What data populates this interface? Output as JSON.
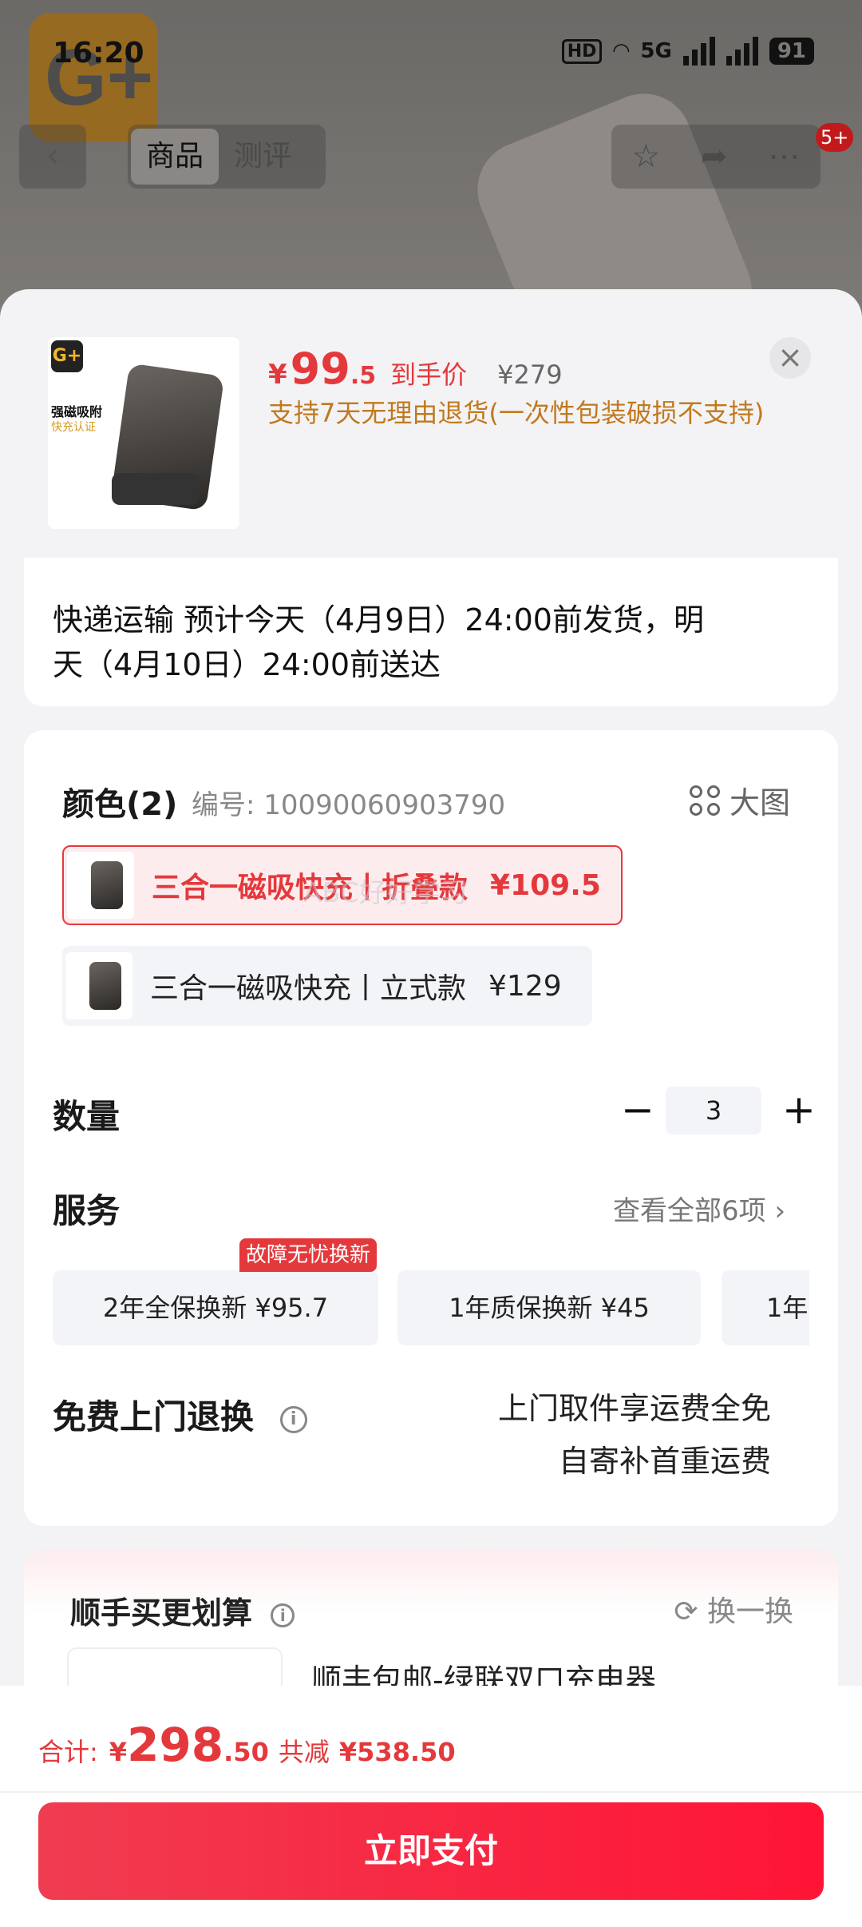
{
  "status_bar": {
    "time": "16:20",
    "hd": "HD",
    "network": "5G",
    "battery": "91"
  },
  "nav": {
    "back_icon": "chevron-left-icon",
    "tabs": [
      "商品",
      "测评"
    ],
    "active_tab": 0,
    "badge": "5+"
  },
  "product": {
    "currency": "¥",
    "price_int": "99",
    "price_dec": ".5",
    "price_label": "到手价",
    "orig_price": "¥279",
    "return_note": "支持7天无理由退货(一次性包装破损不支持)",
    "thumb_text_1": "强磁吸附",
    "thumb_text_2": "快充认证",
    "logo_text": "G+"
  },
  "shipping": {
    "line1": "快递运输 预计今天（4月9日）24:00前发货，明",
    "line2": "天（4月10日）24:00前送达"
  },
  "color": {
    "title": "颜色(2)",
    "code": "编号: 10090060903790",
    "big_image": "大图",
    "variants": [
      {
        "name": "三合一磁吸快充丨折叠款",
        "price": "¥109.5",
        "selected": true
      },
      {
        "name": "三合一磁吸快充丨立式款",
        "price": "¥129",
        "selected": false
      }
    ],
    "watermark": "ABC好好学习"
  },
  "quantity": {
    "label": "数量",
    "value": "3",
    "minus": "−",
    "plus": "+"
  },
  "services": {
    "label": "服务",
    "view_all": "查看全部6项",
    "badge": "故障无忧换新",
    "chips": [
      "2年全保换新  ¥95.7",
      "1年质保换新  ¥45",
      "1年"
    ]
  },
  "door_return": {
    "label": "免费上门退换",
    "line1": "上门取件享运费全免",
    "line2": "自寄补首重运费"
  },
  "bundle": {
    "title": "顺手买更划算",
    "swap": "换一换",
    "item_name": "顺丰包邮-绿联双口充电器"
  },
  "footer": {
    "total_label": "合计:",
    "currency": "¥",
    "total_int": "298",
    "total_dec": ".50",
    "save_label": "共减",
    "save_amount": "¥538.50",
    "pay_label": "立即支付"
  },
  "colors": {
    "accent": "#e4393c",
    "gold": "#c07a1e",
    "pay_button": "#ff1436"
  }
}
